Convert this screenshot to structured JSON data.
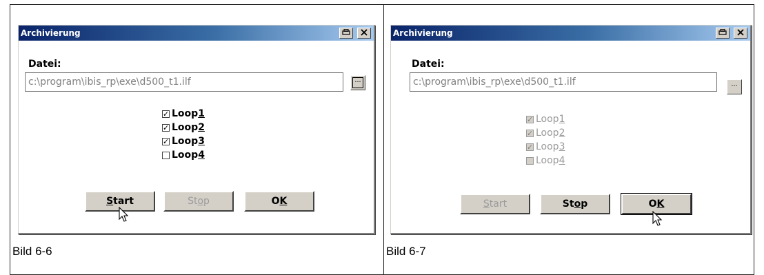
{
  "figures": [
    {
      "caption": "Bild 6-6",
      "dialog": {
        "title": "Archivierung",
        "datei_label": "Datei:",
        "file_path": "c:\\program\\ibis_rp\\exe\\d500_t1.ilf",
        "loops": [
          {
            "prefix": "Loop ",
            "num": "1",
            "checked": true,
            "enabled": true
          },
          {
            "prefix": "Loop ",
            "num": "2",
            "checked": true,
            "enabled": true
          },
          {
            "prefix": "Loop ",
            "num": "3",
            "checked": true,
            "enabled": true
          },
          {
            "prefix": "Loop ",
            "num": "4",
            "checked": false,
            "enabled": true
          }
        ],
        "buttons": {
          "start": {
            "pre": "",
            "ul": "S",
            "post": "tart",
            "enabled": true
          },
          "stop": {
            "pre": "St",
            "ul": "o",
            "post": "p",
            "enabled": false
          },
          "ok": {
            "pre": "O",
            "ul": "K",
            "post": "",
            "enabled": true
          }
        }
      }
    },
    {
      "caption": "Bild 6-7",
      "dialog": {
        "title": "Archivierung",
        "datei_label": "Datei:",
        "file_path": "c:\\program\\ibis_rp\\exe\\d500_t1.ilf",
        "loops": [
          {
            "prefix": "Loop ",
            "num": "1",
            "checked": true,
            "enabled": false
          },
          {
            "prefix": "Loop ",
            "num": "2",
            "checked": true,
            "enabled": false
          },
          {
            "prefix": "Loop ",
            "num": "3",
            "checked": true,
            "enabled": false
          },
          {
            "prefix": "Loop ",
            "num": "4",
            "checked": false,
            "enabled": false
          }
        ],
        "buttons": {
          "start": {
            "pre": "",
            "ul": "S",
            "post": "tart",
            "enabled": false
          },
          "stop": {
            "pre": "St",
            "ul": "o",
            "post": "p",
            "enabled": true
          },
          "ok": {
            "pre": "O",
            "ul": "K",
            "post": "",
            "enabled": true
          }
        }
      }
    }
  ],
  "icons": {
    "print": "printer-icon",
    "close": "close-icon",
    "browse": "ellipsis-icon",
    "cursor": "mouse-pointer-icon"
  },
  "colors": {
    "titlebar_start": "#0a246a",
    "titlebar_end": "#a6caf0",
    "button_face": "#d4d0c8",
    "disabled_text": "#9a9a9a"
  }
}
